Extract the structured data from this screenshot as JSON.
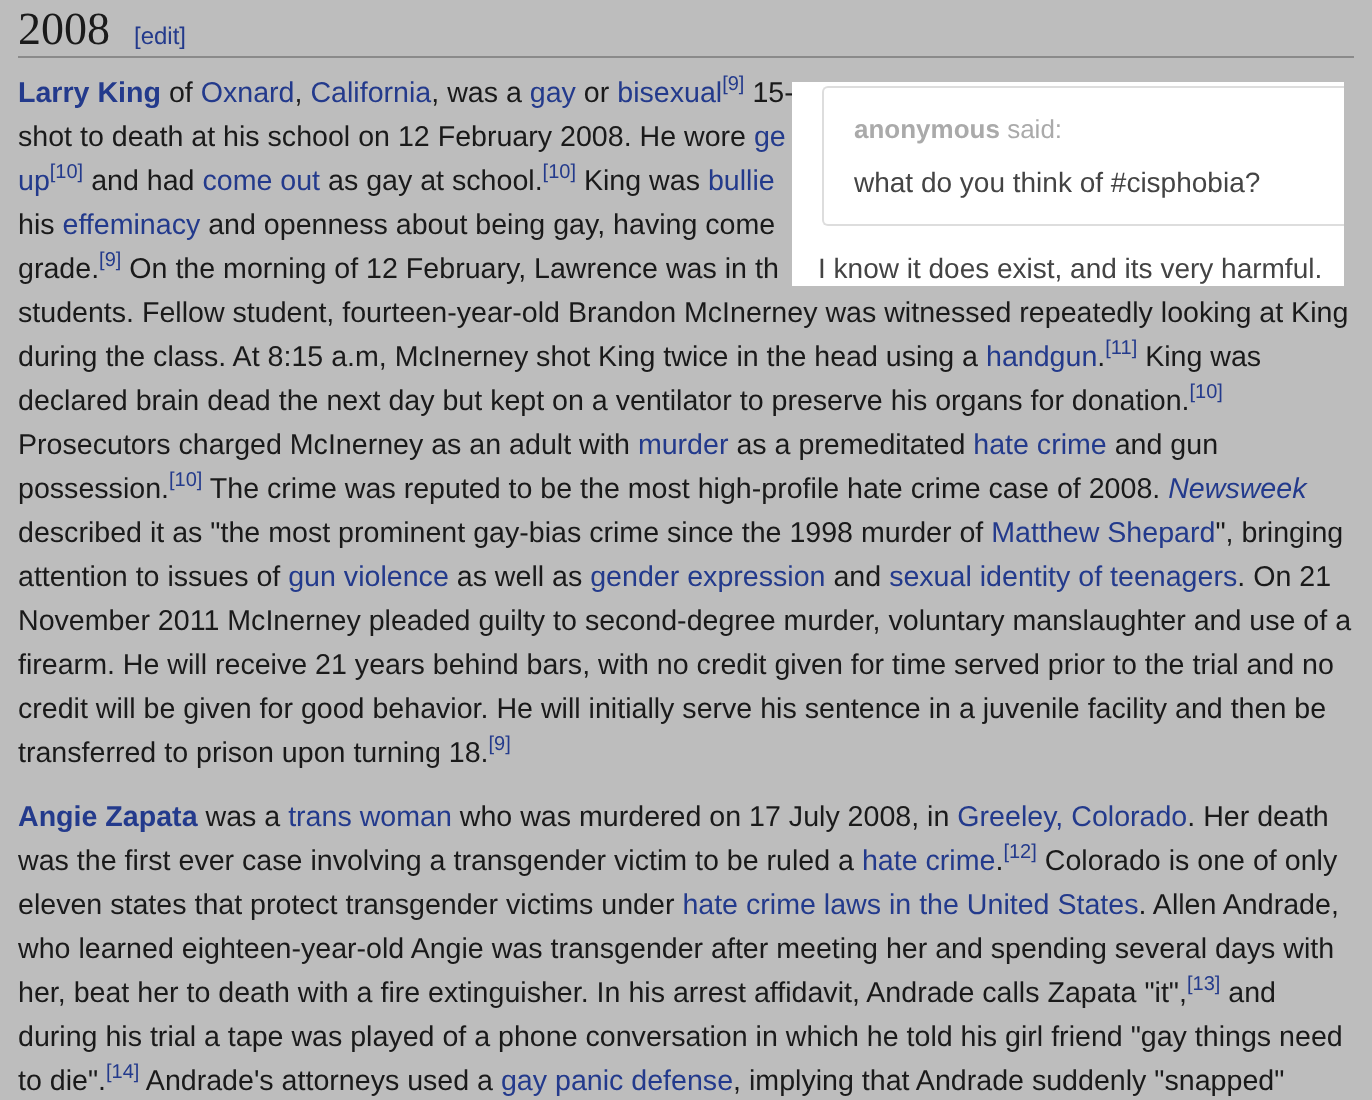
{
  "section": {
    "title": "2008",
    "edit_link": "[edit]"
  },
  "paragraphs": [
    {
      "cut_lines": [
        [
          {
            "kind": "bold_link",
            "text": "Larry King"
          },
          {
            "kind": "text",
            "text": " of "
          },
          {
            "kind": "link",
            "text": "Oxnard"
          },
          {
            "kind": "text",
            "text": ", "
          },
          {
            "kind": "link",
            "text": "California"
          },
          {
            "kind": "text",
            "text": ", was a "
          },
          {
            "kind": "link",
            "text": "gay"
          },
          {
            "kind": "text",
            "text": " or "
          },
          {
            "kind": "link",
            "text": "bisexual"
          },
          {
            "kind": "ref",
            "text": "[9]"
          },
          {
            "kind": "text",
            "text": " 15-"
          }
        ],
        [
          {
            "kind": "text",
            "text": "shot to death at his school on 12 February 2008. He wore "
          },
          {
            "kind": "link",
            "text": "ge"
          }
        ],
        [
          {
            "kind": "link",
            "text": "up"
          },
          {
            "kind": "ref",
            "text": "[10]"
          },
          {
            "kind": "text",
            "text": " and had "
          },
          {
            "kind": "link",
            "text": "come out"
          },
          {
            "kind": "text",
            "text": " as gay at school."
          },
          {
            "kind": "ref",
            "text": "[10]"
          },
          {
            "kind": "text",
            "text": " King was "
          },
          {
            "kind": "link",
            "text": "bullie"
          }
        ],
        [
          {
            "kind": "text",
            "text": "his "
          },
          {
            "kind": "link",
            "text": "effeminacy"
          },
          {
            "kind": "text",
            "text": " and openness about being gay, having come"
          }
        ],
        [
          {
            "kind": "text",
            "text": "grade."
          },
          {
            "kind": "ref",
            "text": "[9]"
          },
          {
            "kind": "text",
            "text": " On the morning of 12 February, Lawrence was in th"
          }
        ]
      ],
      "segments": [
        {
          "kind": "text",
          "text": "students. Fellow student, fourteen-year-old Brandon McInerney was witnessed repeatedly looking at King during the class. At 8:15 a.m, McInerney shot King twice in the head using a "
        },
        {
          "kind": "link",
          "text": "handgun"
        },
        {
          "kind": "text",
          "text": "."
        },
        {
          "kind": "ref",
          "text": "[11]"
        },
        {
          "kind": "text",
          "text": " King was declared brain dead the next day but kept on a ventilator to preserve his organs for donation."
        },
        {
          "kind": "ref",
          "text": "[10]"
        },
        {
          "kind": "text",
          "text": " Prosecutors charged McInerney as an adult with "
        },
        {
          "kind": "link",
          "text": "murder"
        },
        {
          "kind": "text",
          "text": " as a premeditated "
        },
        {
          "kind": "link",
          "text": "hate crime"
        },
        {
          "kind": "text",
          "text": " and gun possession."
        },
        {
          "kind": "ref",
          "text": "[10]"
        },
        {
          "kind": "text",
          "text": " The crime was reputed to be the most high-profile hate crime case of 2008. "
        },
        {
          "kind": "italic_link",
          "text": "Newsweek"
        },
        {
          "kind": "text",
          "text": " described it as \"the most prominent gay-bias crime since the 1998 murder of "
        },
        {
          "kind": "link",
          "text": "Matthew Shepard"
        },
        {
          "kind": "text",
          "text": "\", bringing attention to issues of "
        },
        {
          "kind": "link",
          "text": "gun violence"
        },
        {
          "kind": "text",
          "text": " as well as "
        },
        {
          "kind": "link",
          "text": "gender expression"
        },
        {
          "kind": "text",
          "text": " and "
        },
        {
          "kind": "link",
          "text": "sexual identity of teenagers"
        },
        {
          "kind": "text",
          "text": ". On 21 November 2011 McInerney pleaded guilty to second-degree murder, voluntary manslaughter and use of a firearm. He will receive 21 years behind bars, with no credit given for time served prior to the trial and no credit will be given for good behavior. He will initially serve his sentence in a juvenile facility and then be transferred to prison upon turning 18."
        },
        {
          "kind": "ref",
          "text": "[9]"
        }
      ]
    },
    {
      "segments": [
        {
          "kind": "bold_link",
          "text": "Angie Zapata"
        },
        {
          "kind": "text",
          "text": " was a "
        },
        {
          "kind": "link",
          "text": "trans woman"
        },
        {
          "kind": "text",
          "text": " who was murdered on 17 July 2008, in "
        },
        {
          "kind": "link",
          "text": "Greeley, Colorado"
        },
        {
          "kind": "text",
          "text": ". Her death was the first ever case involving a transgender victim to be ruled a "
        },
        {
          "kind": "link",
          "text": "hate crime"
        },
        {
          "kind": "text",
          "text": "."
        },
        {
          "kind": "ref",
          "text": "[12]"
        },
        {
          "kind": "text",
          "text": " Colorado is one of only eleven states that protect transgender victims under "
        },
        {
          "kind": "link",
          "text": "hate crime laws in the United States"
        },
        {
          "kind": "text",
          "text": ". Allen Andrade, who learned eighteen-year-old Angie was transgender after meeting her and spending several days with her, beat her to death with a fire extinguisher. In his arrest affidavit, Andrade calls Zapata \"it\","
        },
        {
          "kind": "ref",
          "text": "[13]"
        },
        {
          "kind": "text",
          "text": " and during his trial a tape was played of a phone conversation in which he told his girl friend \"gay things need to die\"."
        },
        {
          "kind": "ref",
          "text": "[14]"
        },
        {
          "kind": "text",
          "text": " Andrade's attorneys used a "
        },
        {
          "kind": "link",
          "text": "gay panic defense"
        },
        {
          "kind": "text",
          "text": ", implying that Andrade suddenly \"snapped\""
        }
      ]
    }
  ],
  "ask": {
    "asker": "anonymous",
    "said": "said:",
    "question": "what do you think of #cisphobia?",
    "answer": "I know it does exist, and its very harmful."
  }
}
